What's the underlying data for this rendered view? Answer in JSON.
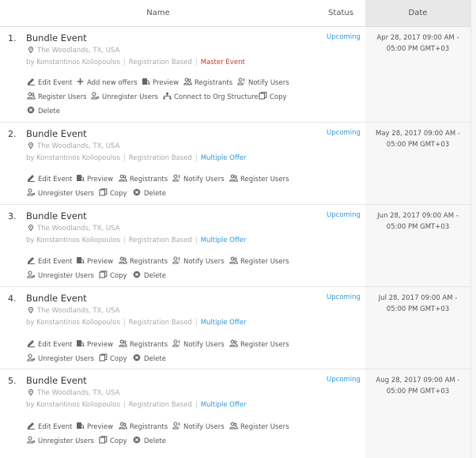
{
  "header": {
    "name": "Name",
    "status": "Status",
    "date": "Date"
  },
  "labels": {
    "edit": "Edit Event",
    "add_offers": "Add new offers",
    "preview": "Preview",
    "registrants": "Registrants",
    "notify": "Notify Users",
    "register": "Register Users",
    "unregister": "Unregister Users",
    "connect": "Connect to Org Structure",
    "copy": "Copy",
    "delete": "Delete",
    "sep": "|"
  },
  "rows": [
    {
      "num": "1.",
      "title": "Bundle Event",
      "location": "The Woodlands, TX, USA",
      "by": "by Konstantinos Koliopoulos",
      "registration": "Registration Based",
      "tag": "Master Event",
      "status": "Upcoming",
      "date": "Apr 28, 2017 09:00 AM - 05:00 PM GMT+03"
    },
    {
      "num": "2.",
      "title": "Bundle Event",
      "location": "The Woodlands, TX, USA",
      "by": "by Konstantinos Koliopoulos",
      "registration": "Registration Based",
      "tag": "Multiple Offer",
      "status": "Upcoming",
      "date": "May 28, 2017 09:00 AM - 05:00 PM GMT+03"
    },
    {
      "num": "3.",
      "title": "Bundle Event",
      "location": "The Woodlands, TX, USA",
      "by": "by Konstantinos Koliopoulos",
      "registration": "Registration Based",
      "tag": "Multiple Offer",
      "status": "Upcoming",
      "date": "Jun 28, 2017 09:00 AM - 05:00 PM GMT+03"
    },
    {
      "num": "4.",
      "title": "Bundle Event",
      "location": "The Woodlands, TX, USA",
      "by": "by Konstantinos Koliopoulos",
      "registration": "Registration Based",
      "tag": "Multiple Offer",
      "status": "Upcoming",
      "date": "Jul 28, 2017 09:00 AM - 05:00 PM GMT+03"
    },
    {
      "num": "5.",
      "title": "Bundle Event",
      "location": "The Woodlands, TX, USA",
      "by": "by Konstantinos Koliopoulos",
      "registration": "Registration Based",
      "tag": "Multiple Offer",
      "status": "Upcoming",
      "date": "Aug 28, 2017 09:00 AM - 05:00 PM GMT+03"
    }
  ]
}
